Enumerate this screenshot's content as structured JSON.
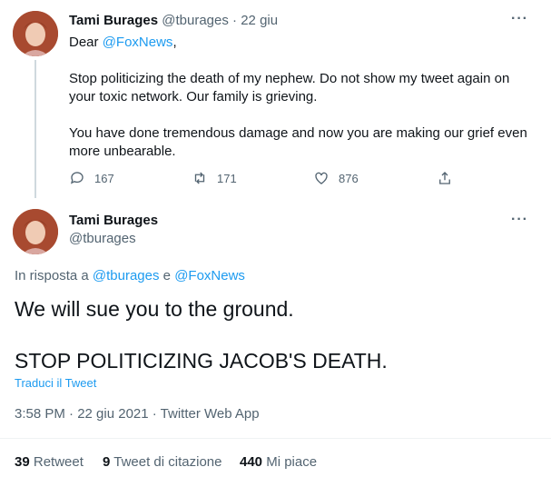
{
  "tweet1": {
    "author_name": "Tami Burages",
    "handle": "@tburages",
    "separator": "·",
    "date": "22 giu",
    "greeting_prefix": "Dear ",
    "greeting_mention": "@FoxNews",
    "greeting_suffix": ",",
    "paragraph1": "Stop politicizing the death of my nephew. Do not show my tweet again on your toxic network. Our family is grieving.",
    "paragraph2": "You have done tremendous damage and now you are making our grief even more unbearable.",
    "replies": "167",
    "retweets": "171",
    "likes": "876"
  },
  "tweet2": {
    "author_name": "Tami Burages",
    "handle": "@tburages",
    "reply_prefix": "In risposta a ",
    "reply_mention1": "@tburages",
    "reply_join": " e ",
    "reply_mention2": "@FoxNews",
    "line1": "We will sue you to the ground.",
    "line2": "STOP POLITICIZING JACOB'S DEATH.",
    "translate": "Traduci il Tweet",
    "timestamp": "3:58 PM · 22 giu 2021 · Twitter Web App",
    "stats": {
      "retweets_count": "39",
      "retweets_label": "Retweet",
      "quotes_count": "9",
      "quotes_label": "Tweet di citazione",
      "likes_count": "440",
      "likes_label": "Mi piace"
    }
  },
  "more_glyph": "···",
  "colors": {
    "link": "#1d9bf0",
    "muted": "#536471",
    "text": "#0f1419"
  }
}
